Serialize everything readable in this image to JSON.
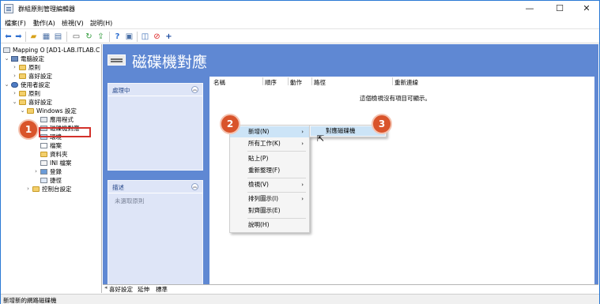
{
  "window": {
    "title": "群組原則管理編輯器",
    "minimize": "—",
    "maximize": "☐",
    "close": "✕"
  },
  "menubar": [
    "檔案(F)",
    "動作(A)",
    "檢視(V)",
    "說明(H)"
  ],
  "toolbar_icons": [
    "back-icon",
    "forward-icon",
    "up-folder-icon",
    "show-tree-icon",
    "export-list-icon",
    "properties-icon",
    "refresh-icon",
    "export-icon",
    "help-icon",
    "action-icon",
    "new-icon",
    "delete-icon",
    "add-icon"
  ],
  "tree": {
    "root": "Mapping O [AD1-LAB.ITLAB.C",
    "items": [
      {
        "label": "電腦設定",
        "icon": "computer-icon"
      },
      {
        "label": "原則",
        "icon": "folder-icon"
      },
      {
        "label": "喜好設定",
        "icon": "folder-icon"
      },
      {
        "label": "使用者設定",
        "icon": "user-icon"
      },
      {
        "label": "原則",
        "icon": "folder-icon"
      },
      {
        "label": "喜好設定",
        "icon": "folder-icon"
      },
      {
        "label": "Windows 設定",
        "icon": "folder-icon"
      },
      {
        "label": "應用程式",
        "icon": "application-icon"
      },
      {
        "label": "磁碟機對應",
        "icon": "drive-map-icon"
      },
      {
        "label": "環境",
        "icon": "environment-icon"
      },
      {
        "label": "檔案",
        "icon": "file-icon"
      },
      {
        "label": "資料夾",
        "icon": "folder-icon"
      },
      {
        "label": "INI 檔案",
        "icon": "ini-file-icon"
      },
      {
        "label": "登錄",
        "icon": "registry-icon"
      },
      {
        "label": "捷徑",
        "icon": "shortcut-icon"
      },
      {
        "label": "控制台設定",
        "icon": "control-panel-icon"
      }
    ]
  },
  "callouts": [
    "1",
    "2",
    "3"
  ],
  "header": {
    "title": "磁碟機對應"
  },
  "panels": {
    "processing": {
      "title": "處理中",
      "collapse": "︽"
    },
    "description": {
      "title": "描述",
      "text": "未選取原則",
      "collapse": "︽"
    }
  },
  "list": {
    "columns": [
      "名稱",
      "順序",
      "動作",
      "路徑",
      "重新連線"
    ],
    "empty_message": "這個檢視沒有項目可顯示。"
  },
  "context_menu": {
    "items": [
      {
        "label": "新增(N)",
        "arrow": "›"
      },
      {
        "label": "所有工作(K)",
        "arrow": "›"
      },
      {
        "label": "貼上(P)"
      },
      {
        "label": "重新整理(F)"
      },
      {
        "label": "檢視(V)",
        "arrow": "›"
      },
      {
        "label": "排列圖示(I)",
        "arrow": "›"
      },
      {
        "label": "對齊圖示(E)"
      },
      {
        "label": "說明(H)"
      }
    ]
  },
  "submenu": {
    "item": "對應磁碟機"
  },
  "bottom_tabs": [
    "喜好設定",
    "延伸",
    "標準"
  ],
  "status": "新增新的網路磁碟機"
}
